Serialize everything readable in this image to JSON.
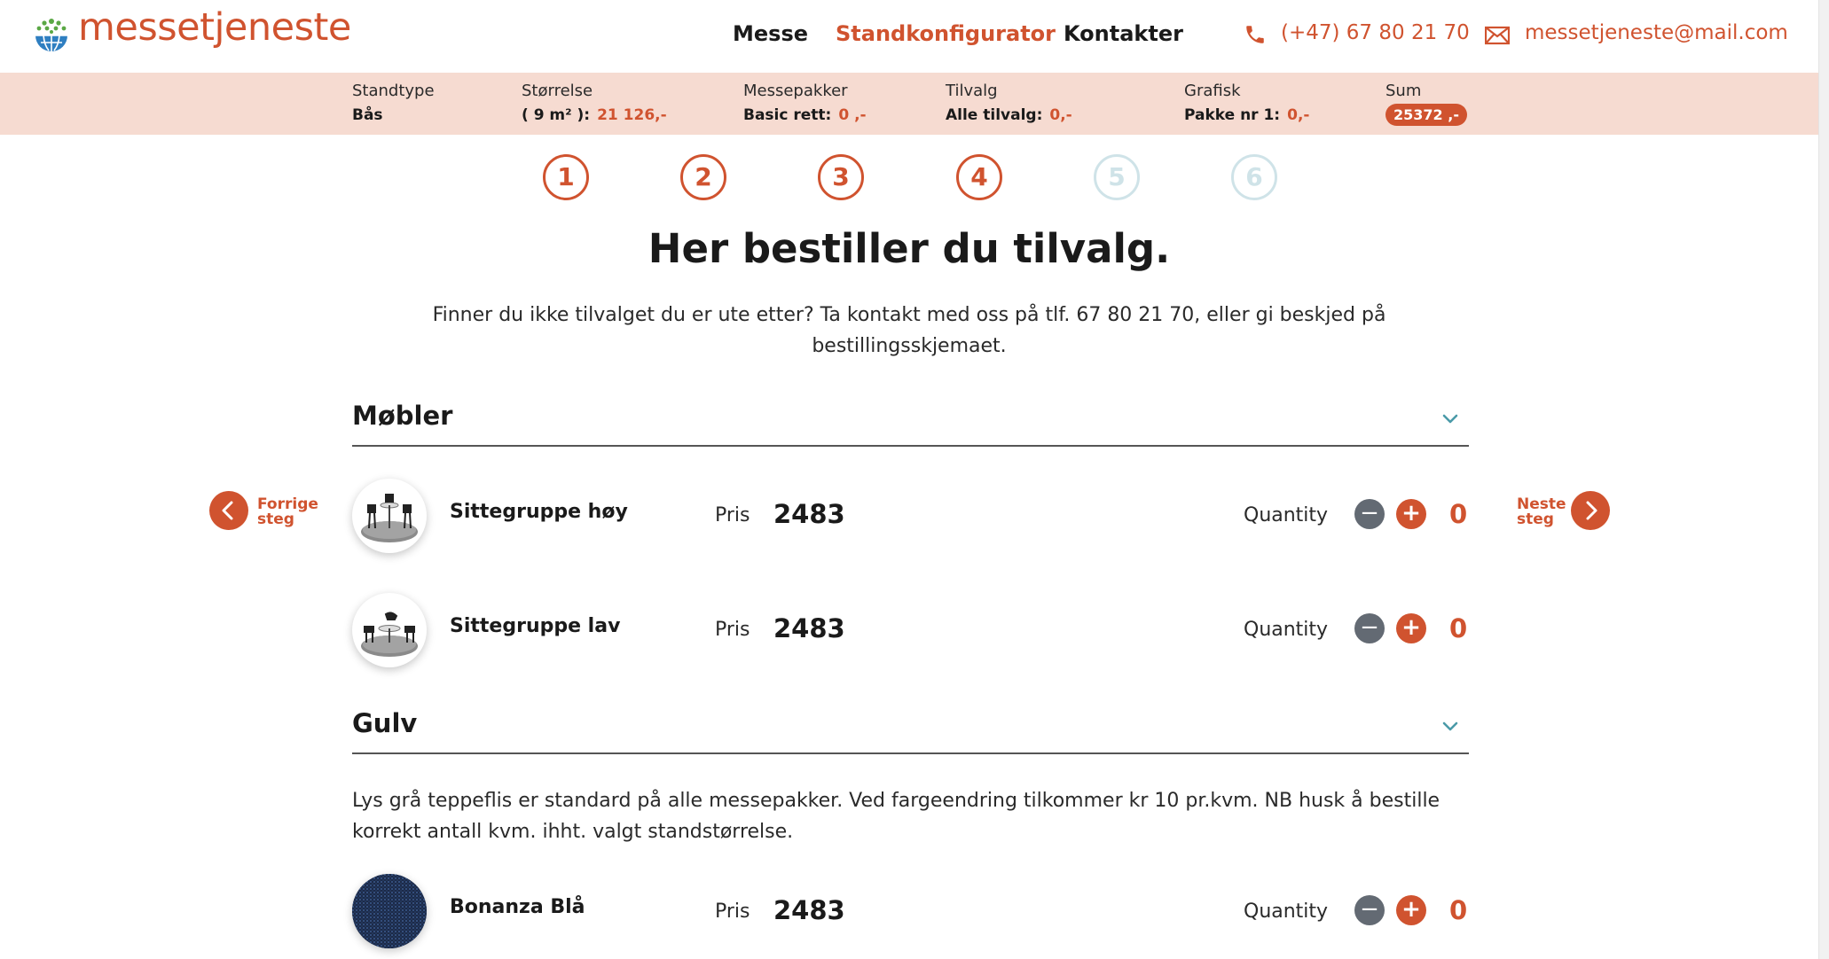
{
  "header": {
    "logo_text": "messetjeneste",
    "nav": [
      {
        "label": "Messe",
        "active": false
      },
      {
        "label": "Standkonfigurator",
        "active": true
      },
      {
        "label": "Kontakter",
        "active": false
      }
    ],
    "phone": "(+47) 67 80 21 70",
    "email": "messetjeneste@mail.com"
  },
  "summary": {
    "standtype": {
      "label": "Standtype",
      "value": "Bås"
    },
    "storrelse": {
      "label": "Størrelse",
      "value": "( 9 m² ):",
      "amount": "21 126,-"
    },
    "messepakker": {
      "label": "Messepakker",
      "value": "Basic rett:",
      "amount": "0 ,-"
    },
    "tilvalg": {
      "label": "Tilvalg",
      "value": "Alle tilvalg:",
      "amount": "0,-"
    },
    "grafisk": {
      "label": "Grafisk",
      "value": "Pakke nr 1:",
      "amount": "0,-"
    },
    "sum": {
      "label": "Sum",
      "value": "25372 ,-"
    }
  },
  "steps": [
    {
      "label": "1",
      "active": true
    },
    {
      "label": "2",
      "active": true
    },
    {
      "label": "3",
      "active": true
    },
    {
      "label": "4",
      "active": true
    },
    {
      "label": "5",
      "active": false
    },
    {
      "label": "6",
      "active": false
    }
  ],
  "page": {
    "title": "Her bestiller du tilvalg.",
    "intro": "Finner du ikke tilvalget du er ute etter? Ta kontakt med oss på tlf. 67 80 21 70, eller gi beskjed på bestillingsskjemaet."
  },
  "nav_buttons": {
    "prev_line1": "Forrige",
    "prev_line2": "steg",
    "next_line1": "Neste",
    "next_line2": "steg"
  },
  "sections": [
    {
      "title": "Møbler",
      "items": [
        {
          "name": "Sittegruppe høy",
          "price_label": "Pris",
          "price": "2483",
          "qty_label": "Quantity",
          "qty": "0"
        },
        {
          "name": "Sittegruppe lav",
          "price_label": "Pris",
          "price": "2483",
          "qty_label": "Quantity",
          "qty": "0"
        }
      ]
    },
    {
      "title": "Gulv",
      "description": "Lys grå teppeflis er standard på alle messepakker. Ved fargeendring tilkommer kr 10 pr.kvm. NB husk å bestille korrekt antall kvm. ihht. valgt standstørrelse.",
      "items": [
        {
          "name": "Bonanza Blå",
          "price_label": "Pris",
          "price": "2483",
          "qty_label": "Quantity",
          "qty": "0"
        }
      ]
    }
  ],
  "colors": {
    "accent": "#d0532f",
    "summary_bg": "#f6dbd1",
    "step_inactive": "#cfe3e8",
    "minus_button": "#636a73",
    "chevron": "#4a9aa8"
  }
}
